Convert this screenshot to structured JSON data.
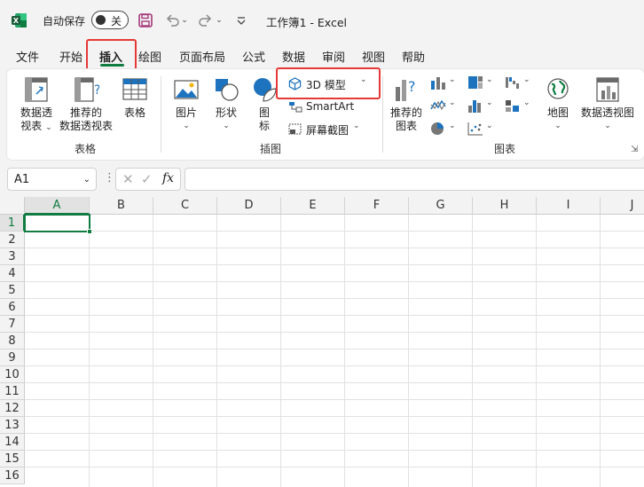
{
  "titlebar": {
    "autosave_label": "自动保存",
    "autosave_state": "关",
    "doc_title": "工作簿1  -  Excel"
  },
  "tabs": [
    "文件",
    "开始",
    "插入",
    "绘图",
    "页面布局",
    "公式",
    "数据",
    "审阅",
    "视图",
    "帮助"
  ],
  "active_tab": "插入",
  "ribbon": {
    "tables": {
      "pivot": [
        "数据透",
        "视表"
      ],
      "recommended_pivot": [
        "推荐的",
        "数据透视表"
      ],
      "table": "表格",
      "group": "表格"
    },
    "illustrations": {
      "pictures": "图片",
      "shapes": "形状",
      "icons": [
        "图",
        "标"
      ],
      "model3d": "3D 模型",
      "smartart": "SmartArt",
      "screenshot": "屏幕截图",
      "group": "插图"
    },
    "charts": {
      "recommended": [
        "推荐的",
        "图表"
      ],
      "map": "地图",
      "pivot_chart": "数据透视图",
      "group": "图表"
    }
  },
  "formula_bar": {
    "name_box": "A1",
    "fx": "fx",
    "formula": ""
  },
  "grid": {
    "columns": [
      "A",
      "B",
      "C",
      "D",
      "E",
      "F",
      "G",
      "H",
      "I",
      "J"
    ],
    "rows": [
      "1",
      "2",
      "3",
      "4",
      "5",
      "6",
      "7",
      "8",
      "9",
      "10",
      "11",
      "12",
      "13",
      "14",
      "15",
      "16"
    ],
    "active_cell": "A1"
  },
  "colors": {
    "accent": "#107c41",
    "highlight": "#e53935"
  }
}
